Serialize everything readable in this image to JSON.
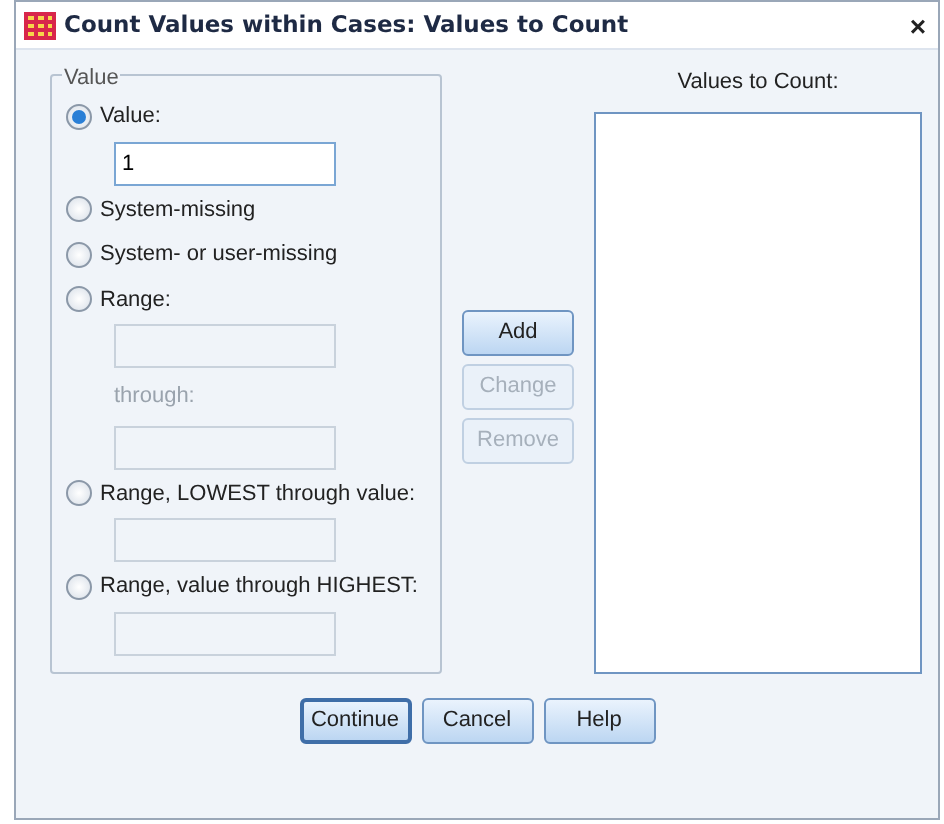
{
  "window": {
    "title": "Count Values within Cases: Values to Count",
    "close": "×"
  },
  "value_group": {
    "legend": "Value",
    "options": [
      {
        "label": "Value:",
        "selected": true,
        "inputs": [
          {
            "kind": "field",
            "value": "1",
            "disabled": false
          }
        ]
      },
      {
        "label": "System-missing",
        "selected": false
      },
      {
        "label": "System- or user-missing",
        "selected": false
      },
      {
        "label": "Range:",
        "selected": false,
        "inputs": [
          {
            "kind": "field",
            "disabled": true
          },
          {
            "kind": "label",
            "text": "through:",
            "disabled": true
          },
          {
            "kind": "field",
            "disabled": true
          }
        ]
      },
      {
        "label": "Range, LOWEST through value:",
        "selected": false,
        "inputs": [
          {
            "kind": "field",
            "disabled": true
          }
        ]
      },
      {
        "label": "Range, value through HIGHEST:",
        "selected": false,
        "inputs": [
          {
            "kind": "field",
            "disabled": true
          }
        ]
      }
    ]
  },
  "middle_buttons": [
    {
      "label": "Add",
      "disabled": false
    },
    {
      "label": "Change",
      "disabled": true
    },
    {
      "label": "Remove",
      "disabled": true
    }
  ],
  "values_list": {
    "label": "Values to Count:"
  },
  "footer_buttons": [
    {
      "label": "Continue",
      "default": true
    },
    {
      "label": "Cancel",
      "default": false
    },
    {
      "label": "Help",
      "default": false
    }
  ]
}
